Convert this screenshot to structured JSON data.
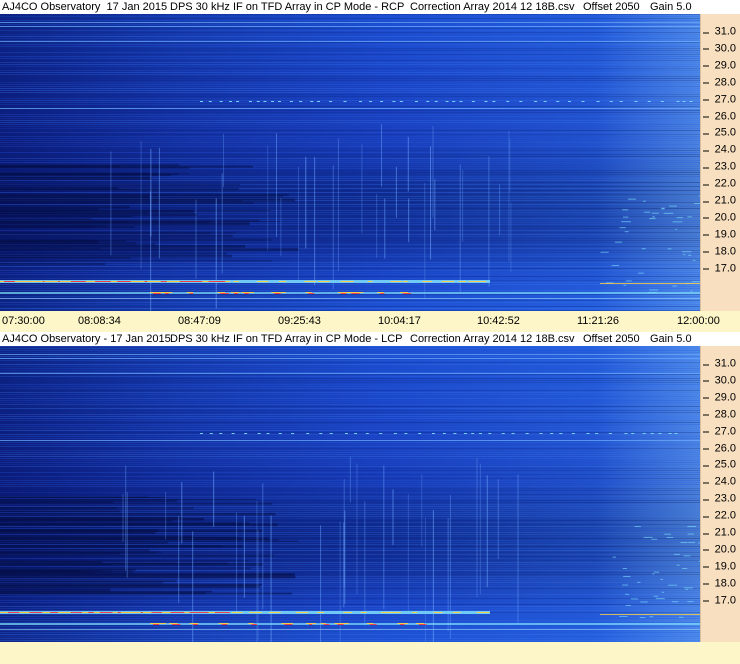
{
  "colors": {
    "background_blue": "#1a45c7",
    "dark_blue": "#0e2a8d",
    "axis_panel": "#f7dfc0",
    "time_axis": "#fdf6c8",
    "hot_red": "#ff3030",
    "hot_yellow": "#ffd040",
    "signal_cyan": "#7fe0ff"
  },
  "panels": [
    {
      "id": "rcp",
      "header": {
        "station": "AJ4CO Observatory  17 Jan 2015",
        "instrument": "DPS 30 kHz IF on TFD Array in CP Mode - RCP",
        "correction": "Correction Array 2014 12 18B.csv",
        "offset": "Offset 2050",
        "gain": "Gain 5.0"
      },
      "freq_ticks": [
        "31.0",
        "30.0",
        "29.0",
        "28.0",
        "27.0",
        "26.0",
        "25.0",
        "24.0",
        "23.0",
        "22.0",
        "21.0",
        "20.0",
        "19.0",
        "18.0",
        "17.0"
      ],
      "time_ticks": [
        "07:30:00",
        "08:08:34",
        "08:47:09",
        "09:25:43",
        "10:04:17",
        "10:42:52",
        "11:21:26",
        "12:00:00"
      ]
    },
    {
      "id": "lcp",
      "header": {
        "station": "AJ4CO Observatory - 17 Jan 2015",
        "instrument": "DPS 30 kHz IF on TFD Array in CP Mode - LCP",
        "correction": "Correction Array 2014 12 18B.csv",
        "offset": "Offset 2050",
        "gain": "Gain 5.0"
      },
      "freq_ticks": [
        "31.0",
        "30.0",
        "29.0",
        "28.0",
        "27.0",
        "26.0",
        "25.0",
        "24.0",
        "23.0",
        "22.0",
        "21.0",
        "20.0",
        "19.0",
        "18.0",
        "17.0"
      ],
      "time_ticks": []
    }
  ]
}
